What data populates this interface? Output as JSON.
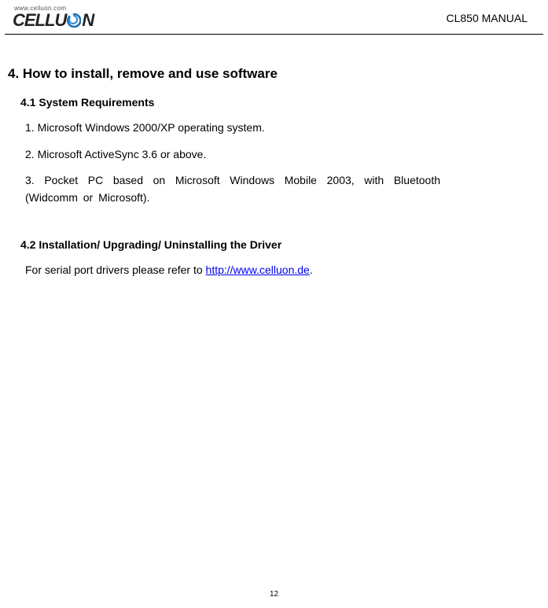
{
  "header": {
    "logo_url": "www.celluon.com",
    "logo_text_left": "CELLU",
    "logo_text_right": "N",
    "manual_title": "CL850 MANUAL"
  },
  "content": {
    "section_title": "4. How to install, remove and use software",
    "sub1_title": "4.1 System Requirements",
    "item1": "1. Microsoft Windows 2000/XP operating system.",
    "item2": "2. Microsoft ActiveSync 3.6 or above.",
    "item3": "3. Pocket PC based on Microsoft Windows Mobile 2003, with Bluetooth (Widcomm or Microsoft).",
    "sub2_title": "4.2    Installation/ Upgrading/ Uninstalling the Driver",
    "driver_text_prefix": "For serial port drivers please refer to ",
    "driver_link": "http://www.celluon.de",
    "driver_text_suffix": "."
  },
  "footer": {
    "page_number": "12"
  }
}
